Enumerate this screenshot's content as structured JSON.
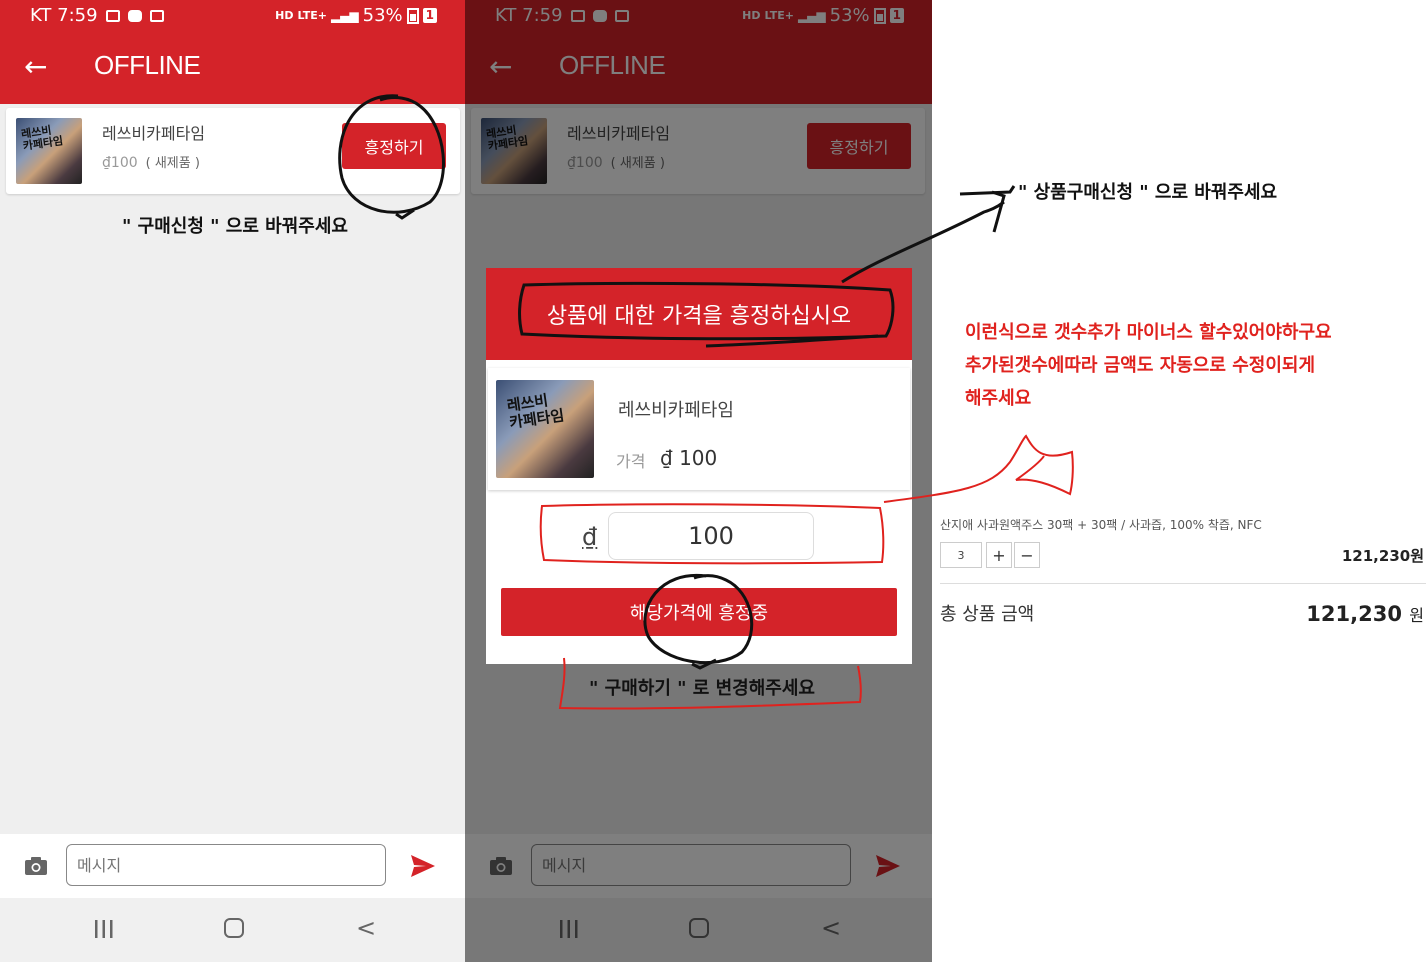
{
  "status_bar": {
    "carrier_time": "KT 7:59",
    "network": "LTE+",
    "hd": "HD",
    "battery": "53%",
    "box_count": "1"
  },
  "app_bar": {
    "back_icon": "arrow-left-icon",
    "title": "OFFLINE"
  },
  "product": {
    "name": "레쓰비카페타임",
    "price": "₫100",
    "condition": "( 새제품 )",
    "thumb_text": "레쓰비\n카페타임",
    "haggle_label": "흥정하기"
  },
  "annotations": {
    "p1_request": "\" 구매신청 \" 으로 바꿔주세요",
    "p2_request": "\" 상품구매신청 \" 으로 바꿔주세요",
    "p2_buy": "\" 구매하기 \" 로 변경해주세요",
    "p3_lines": [
      "이런식으로 갯수추가 마이너스 할수있어야하구요",
      "추가된갯수에따라 금액도 자동으로 수정이되게",
      "해주세요"
    ]
  },
  "chat_input": {
    "placeholder": "메시지",
    "camera_icon": "camera-icon",
    "send_icon": "send-icon"
  },
  "nav_bar": {
    "recents_icon": "recents-icon",
    "home_icon": "home-icon",
    "back_icon": "back-chevron-icon"
  },
  "dialog": {
    "title": "상품에 대한 가격을 흥정하십시오",
    "product_name": "레쓰비카페타임",
    "price_label": "가격",
    "price": "₫ 100",
    "currency": "₫",
    "offer_value": "100",
    "submit_label": "해당가격에 흥정중"
  },
  "cart": {
    "product_line": "산지애 사과원액주스 30팩 + 30팩 / 사과즙, 100% 착즙, NFC",
    "quantity": "3",
    "plus": "+",
    "minus": "−",
    "line_price": "121,230원",
    "total_label": "총 상품 금액",
    "total_value": "121,230",
    "total_unit": "원"
  },
  "colors": {
    "brand_red": "#d42329",
    "annotation_red": "#e0221e"
  }
}
